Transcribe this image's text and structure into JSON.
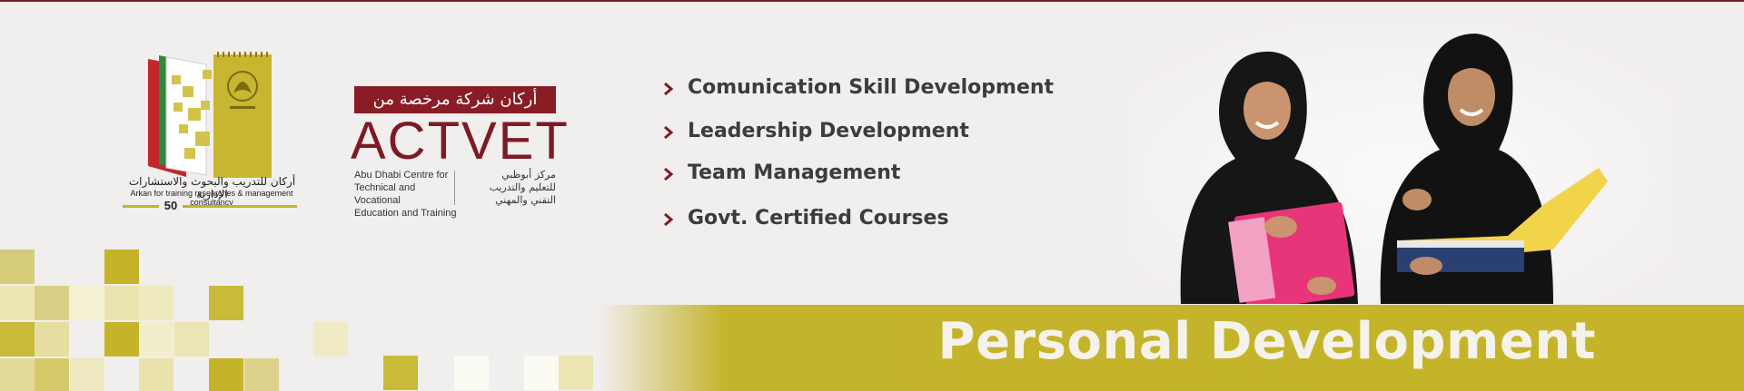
{
  "brand": {
    "arkan_ar": "أركان للتدريب والبحوث والاستشارات الإدارية",
    "arkan_en": "Arkan for training researches & management consultancy",
    "arkan_year": "50",
    "actvet_tag": "أركان شركة مرخصة من",
    "actvet_name": "ACTVET",
    "actvet_en_1": "Abu Dhabi Centre for",
    "actvet_en_2": "Technical and Vocational",
    "actvet_en_3": "Education and Training",
    "actvet_ar_1": "مركز أبوظبي",
    "actvet_ar_2": "للتعليم والتدريب",
    "actvet_ar_3": "التقني والمهني"
  },
  "bullets": [
    "Comunication Skill Development",
    "Leadership Development",
    "Team Management",
    "Govt. Certified Courses"
  ],
  "band_title": "Personal Development",
  "colors": {
    "maroon": "#7e1a25",
    "gold": "#c5b429",
    "background": "#f1eeee",
    "text": "#3c3c3c"
  },
  "icons": [
    "chevron-right-icon",
    "arkan-logo",
    "uae-emblem-icon"
  ]
}
